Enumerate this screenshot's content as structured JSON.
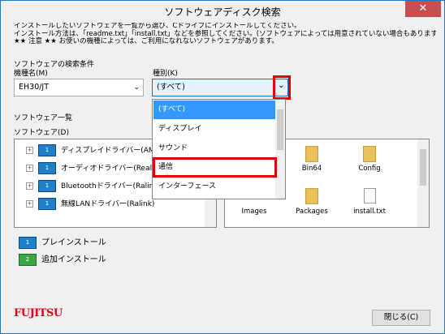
{
  "window": {
    "title": "ソフトウェアディスク検索",
    "close_glyph": "✕"
  },
  "intro": {
    "line1": "インストールしたいソフトウェアを一覧から選び、Cドライブにインストールしてください。",
    "line2": "インストール方法は、「readme.txt」「install.txt」などを参照してください。(ソフトウェアによっては用意されていない場合もあります)",
    "line3": "★★ 注意 ★★ お使いの機種によっては、ご利用になれないソフトウェアがあります。"
  },
  "search": {
    "group_label": "ソフトウェアの検索条件",
    "model_label": "機種名(M)",
    "model_value": "EH30/JT",
    "type_label": "種別(K)",
    "type_value": "(すべて)",
    "type_options": [
      "(すべて)",
      "ディスプレイ",
      "サウンド",
      "通信",
      "インターフェース"
    ],
    "selected_index": 0
  },
  "software_list": {
    "group_label": "ソフトウェア一覧",
    "list_label": "ソフトウェア(D)",
    "items": [
      {
        "name": "ディスプレイドライバー(AMD)",
        "icon": "preinstall-icon"
      },
      {
        "name": "オーディオドライバー(Realtek)",
        "icon": "preinstall-icon"
      },
      {
        "name": "Bluetoothドライバー(Ralink)",
        "icon": "preinstall-icon"
      },
      {
        "name": "無線LANドライバー(Ralink)",
        "icon": "preinstall-icon"
      }
    ]
  },
  "files": [
    {
      "name": "Bin64",
      "type": "folder"
    },
    {
      "name": "Config",
      "type": "folder"
    },
    {
      "name": "Images",
      "type": "folder"
    },
    {
      "name": "Packages",
      "type": "folder"
    },
    {
      "name": "install.txt",
      "type": "file"
    }
  ],
  "legend": {
    "preinstall_label": "プレインストール",
    "addinstall_label": "追加インストール",
    "icon_text": "1",
    "icon_text2": "2"
  },
  "footer": {
    "logo_text": "FUJITSU",
    "close_button": "閉じる(C)"
  },
  "colors": {
    "accent": "#3399ff",
    "highlight_box": "#e00000",
    "logo": "#e60012"
  }
}
